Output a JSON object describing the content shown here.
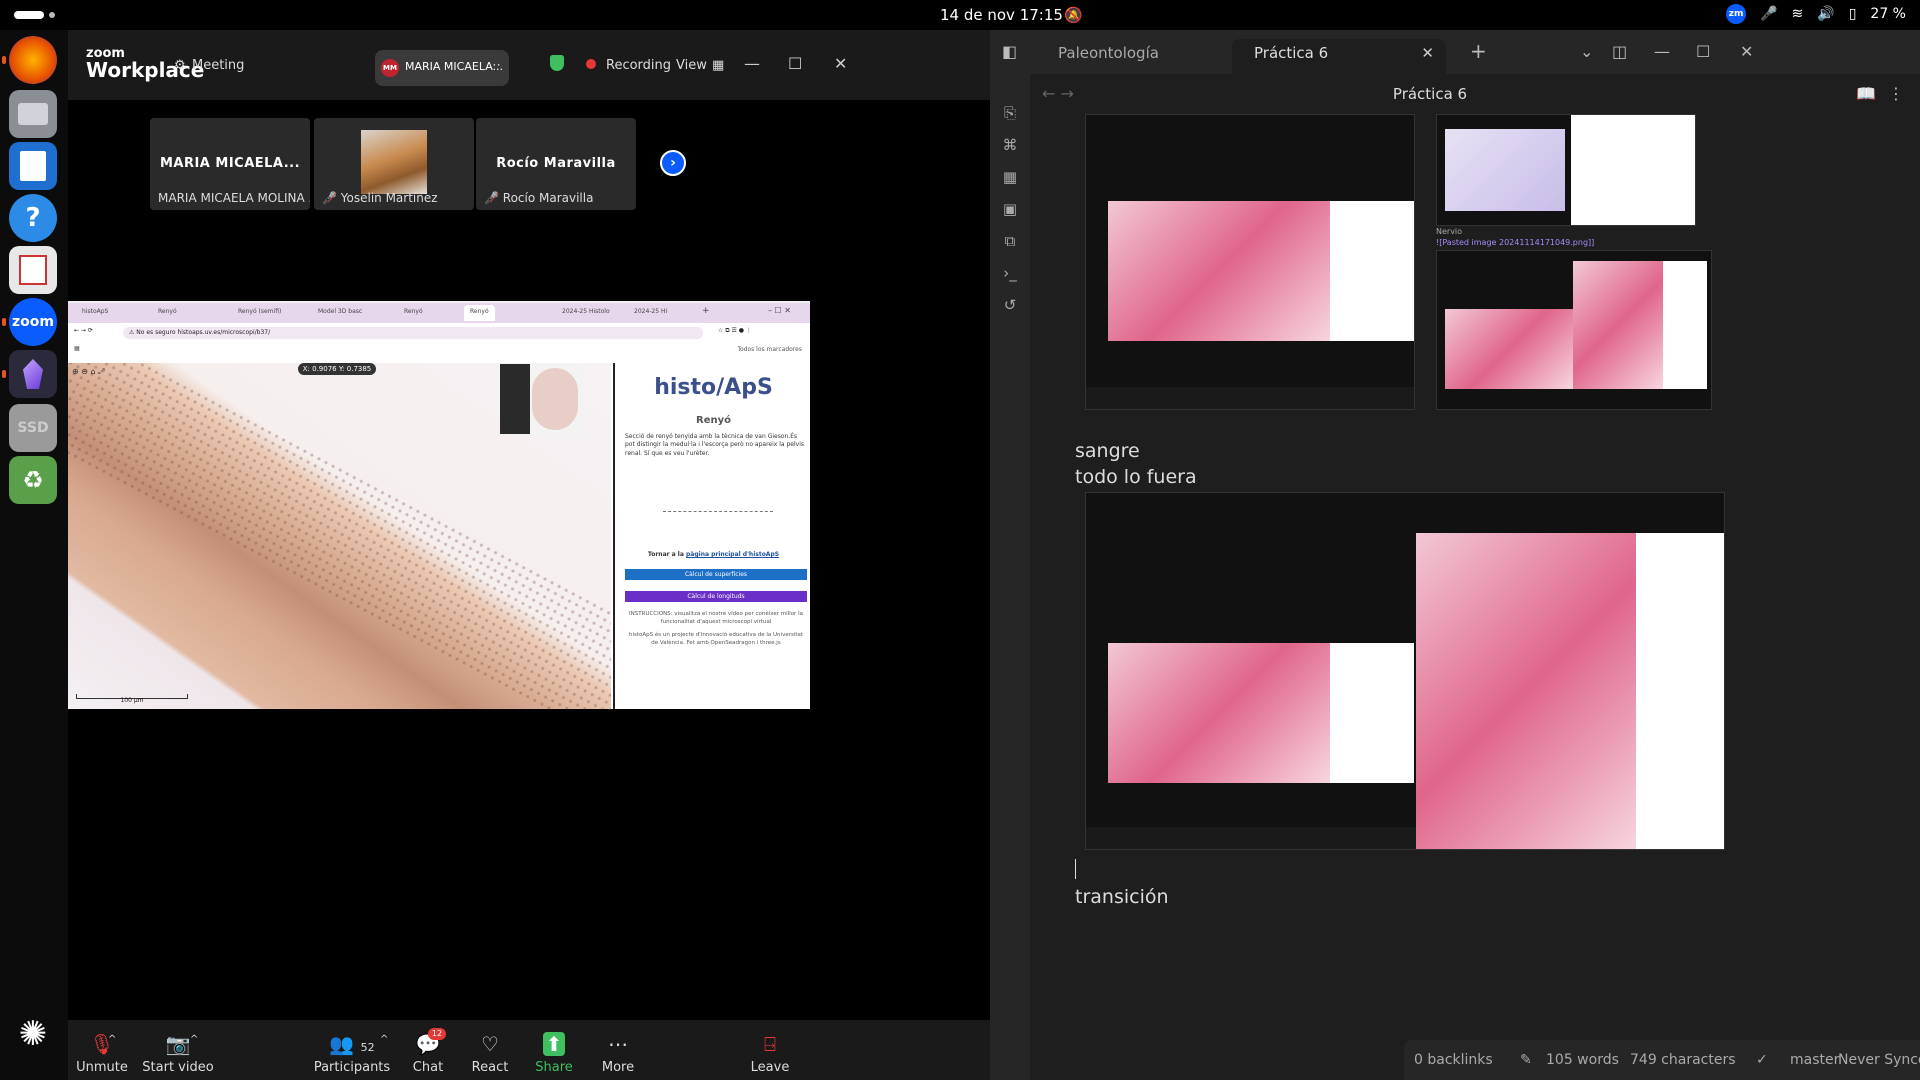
{
  "topbar": {
    "clock": "14 de nov  17:15",
    "battery": "27 %"
  },
  "dock": {
    "items": [
      {
        "name": "firefox",
        "label": ""
      },
      {
        "name": "files",
        "label": ""
      },
      {
        "name": "writer",
        "label": ""
      },
      {
        "name": "help",
        "label": "?"
      },
      {
        "name": "document-viewer",
        "label": ""
      },
      {
        "name": "zoom",
        "label": "zoom"
      },
      {
        "name": "obsidian",
        "label": ""
      },
      {
        "name": "ssd",
        "label": "SSD"
      },
      {
        "name": "trash",
        "label": "♻"
      }
    ]
  },
  "zoom": {
    "logo_small": "zoom",
    "logo_big": "Workplace",
    "meeting_label": "Meeting",
    "pill_initials": "MM",
    "pill_text": "MARIA MICAELA...",
    "recording_label": "Recording",
    "view_label": "View",
    "participants": [
      {
        "big": "MARIA MICAELA...",
        "name": "MARIA MICAELA MOLINA ...",
        "muted": false
      },
      {
        "big": "",
        "name": "Yoselin Martínez",
        "muted": true
      },
      {
        "big": "Rocío Maravilla",
        "name": "Rocío Maravilla",
        "muted": true
      }
    ],
    "toolbar": {
      "unmute": "Unmute",
      "start_video": "Start video",
      "participants": "Participants",
      "participants_count": "52",
      "chat": "Chat",
      "chat_badge": "12",
      "react": "React",
      "share": "Share",
      "more": "More",
      "leave": "Leave"
    }
  },
  "shared": {
    "tabs": [
      "histoApS",
      "Renyó",
      "Renyó (semifi)",
      "Model 3D basc",
      "Renyó",
      "Renyó",
      "2024-25 Histolo",
      "2024-25 Hi"
    ],
    "url_security": "No es seguro",
    "url": "histoaps.uv.es/microscopi/b37/",
    "bookmarks": "Todos los marcadores",
    "coords": "X: 0.9076   Y: 0.7385",
    "scale": "100 µm",
    "histo_logo": "histo/ApS",
    "histo_title": "Renyó",
    "histo_desc": "Secció de renyó tenyida amb la tècnica de van Gieson.És pot distingir la medul·la i l'escorça però no apareix la pelvis renal. Sí que es veu l'urèter.",
    "histo_back_prefix": "Tornar a la ",
    "histo_back_link": "pàgina principal d'histoApS",
    "btn_surface": "Càlcul de superfícies",
    "btn_length": "Càlcul de longituds",
    "instructions": "INSTRUCCIONS: visualitza el nostre vídeo per conèixer millor la funcionalitat d'aquest microscopi virtual",
    "project": "histoApS és un projecte d'innovació educativa de la Universitat de València. Fet amb OpenSeadragon i three.js",
    "colors": {
      "blue_btn": "#1e6fc6",
      "purple_btn": "#6a2fc9"
    }
  },
  "obsidian": {
    "tabs": [
      "Paleontología",
      "Práctica 6"
    ],
    "note_title": "Práctica 6",
    "lines": [
      "sangre",
      "todo lo fuera",
      "transición"
    ],
    "nervio": "Nervio",
    "pasted": "![Pasted image 20241114171049.png]]",
    "status": {
      "backlinks": "0 backlinks",
      "words": "105 words",
      "characters": "749 characters",
      "branch": "master",
      "sync": "Never Synced"
    }
  }
}
